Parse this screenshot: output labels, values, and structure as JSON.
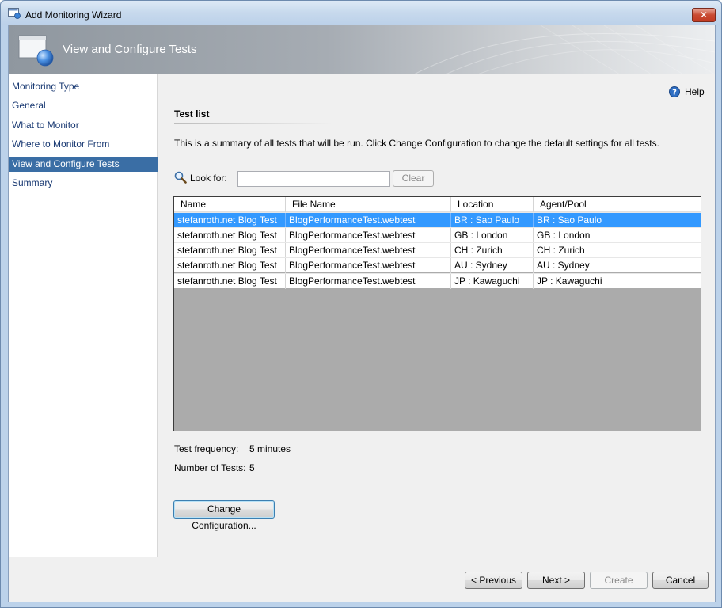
{
  "window": {
    "title": "Add Monitoring Wizard",
    "close_glyph": "✕"
  },
  "banner": {
    "title": "View and Configure Tests"
  },
  "nav": {
    "items": [
      {
        "label": "Monitoring Type",
        "active": false
      },
      {
        "label": "General",
        "active": false
      },
      {
        "label": "What to Monitor",
        "active": false
      },
      {
        "label": "Where to Monitor From",
        "active": false
      },
      {
        "label": "View and Configure Tests",
        "active": true
      },
      {
        "label": "Summary",
        "active": false
      }
    ]
  },
  "help": {
    "label": "Help",
    "icon": "help-icon"
  },
  "section": {
    "title": "Test list",
    "summary": "This is a summary of all tests that will be run. Click Change Configuration to change the default settings for all tests."
  },
  "search": {
    "label": "Look for:",
    "value": "",
    "clear_label": "Clear",
    "icon": "magnifier-icon"
  },
  "grid": {
    "columns": [
      "Name",
      "File Name",
      "Location",
      "Agent/Pool"
    ],
    "rows": [
      [
        "stefanroth.net Blog Test",
        "BlogPerformanceTest.webtest",
        "BR : Sao Paulo",
        "BR : Sao Paulo"
      ],
      [
        "stefanroth.net Blog Test",
        "BlogPerformanceTest.webtest",
        "GB : London",
        "GB : London"
      ],
      [
        "stefanroth.net Blog Test",
        "BlogPerformanceTest.webtest",
        "CH : Zurich",
        "CH : Zurich"
      ],
      [
        "stefanroth.net Blog Test",
        "BlogPerformanceTest.webtest",
        "AU : Sydney",
        "AU : Sydney"
      ],
      [
        "stefanroth.net Blog Test",
        "BlogPerformanceTest.webtest",
        "JP : Kawaguchi",
        "JP : Kawaguchi"
      ]
    ],
    "selected_row": 0
  },
  "meta": {
    "frequency_label": "Test frequency:",
    "frequency_value": "5 minutes",
    "count_label": "Number of Tests:",
    "count_value": "5"
  },
  "change_config": {
    "label": "Change Configuration..."
  },
  "footer": {
    "previous_label": "< Previous",
    "next_label": "Next >",
    "create_label": "Create",
    "cancel_label": "Cancel"
  },
  "colors": {
    "selection": "#3399ff",
    "nav_active": "#3a6ea5",
    "nav_text": "#1a3a73"
  }
}
